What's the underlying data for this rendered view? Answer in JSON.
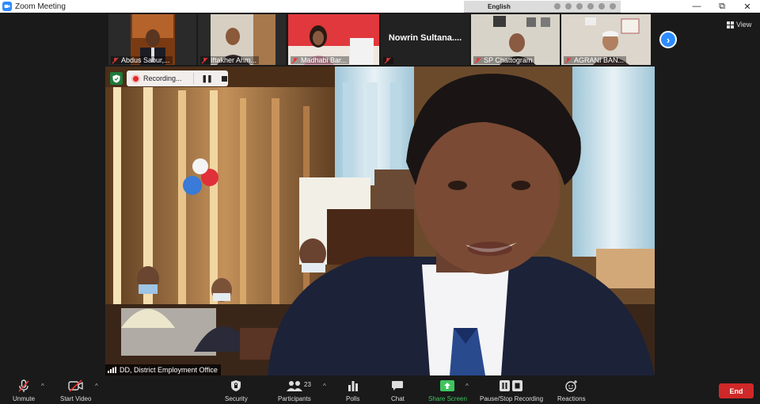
{
  "window": {
    "title": "Zoom Meeting",
    "controls": [
      "minimize-icon",
      "restore-icon",
      "close-icon"
    ]
  },
  "language_bar": {
    "label": "English"
  },
  "thumbnails": [
    {
      "name": "Abdus Sabur,...",
      "muted": true
    },
    {
      "name": "Iftakher Ahm...",
      "muted": true
    },
    {
      "name": "Madhabi Bar...",
      "muted": true
    },
    {
      "name": "Nowrin Sultana....",
      "muted": true,
      "video": false
    },
    {
      "name": "SP Chattogram",
      "muted": true
    },
    {
      "name": "AGRANI BAN...",
      "muted": true
    }
  ],
  "view_button": {
    "label": "View"
  },
  "recording": {
    "label": "Recording..."
  },
  "active_speaker": {
    "name": "DD, District Employment Office"
  },
  "toolbar": {
    "unmute": "Unmute",
    "start_video": "Start Video",
    "security": "Security",
    "participants": "Participants",
    "participant_count": "23",
    "polls": "Polls",
    "chat": "Chat",
    "share_screen": "Share Screen",
    "pause_stop_recording": "Pause/Stop Recording",
    "reactions": "Reactions",
    "end": "End"
  },
  "colors": {
    "accent_blue": "#2d8cff",
    "share_green": "#3ec45f",
    "end_red": "#cf2828",
    "background": "#1a1a1a"
  }
}
